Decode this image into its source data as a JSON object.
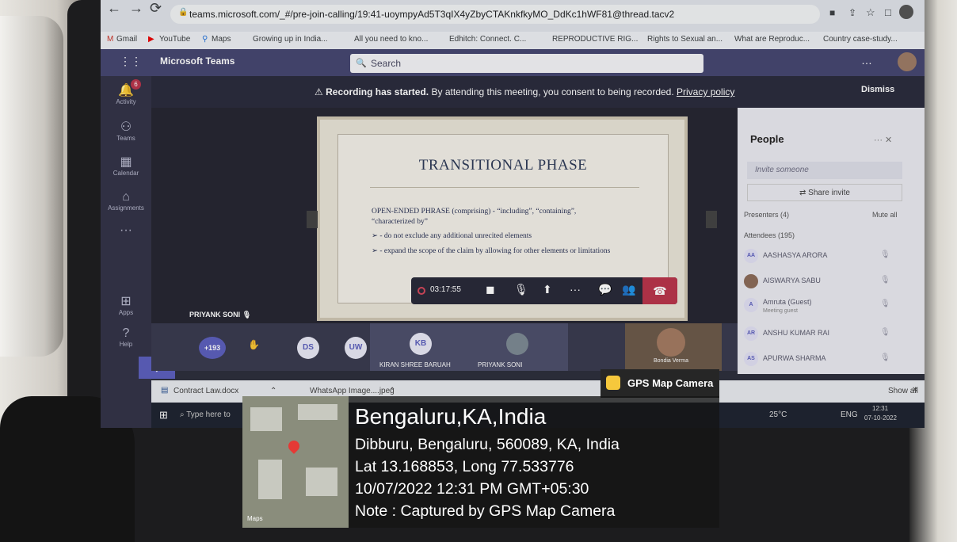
{
  "browser": {
    "url": "teams.microsoft.com/_#/pre-join-calling/19:41-uoympyAd5T3qIX4yZbyCTAKnkfkyMO_DdKc1hWF81@thread.tacv2",
    "bookmarks": [
      "Gmail",
      "YouTube",
      "Maps",
      "Growing up in India...",
      "All you need to kno...",
      "Edhitch: Connect. C...",
      "REPRODUCTIVE RIG...",
      "Rights to Sexual an...",
      "What are Reproduc...",
      "Country case-study..."
    ]
  },
  "teams": {
    "app_title": "Microsoft Teams",
    "search_placeholder": "Search",
    "rail": {
      "activity": "Activity",
      "activity_badge": "6",
      "teams": "Teams",
      "calendar": "Calendar",
      "assignments": "Assignments",
      "apps": "Apps",
      "help": "Help"
    },
    "banner": {
      "bold": "Recording has started.",
      "text": " By attending this meeting, you consent to being recorded. ",
      "link": "Privacy policy",
      "dismiss": "Dismiss"
    },
    "slide": {
      "title": "TRANSITIONAL PHASE",
      "line1": "OPEN-ENDED PHRASE (comprising) - “including”, “containing”,",
      "line2": "“characterized by”",
      "bullet1": "➢ - do not exclude any additional unrecited elements",
      "bullet2": "➢ - expand the scope of the claim by allowing for other elements or limitations"
    },
    "presenter": "PRIYANK SONI",
    "timer": "03:17:55",
    "gallery": {
      "overflow": "+193",
      "avatars": [
        "DS",
        "UW"
      ],
      "kb_initials": "KB",
      "kb_name": "KIRAN SHREE BARUAH",
      "priyank": "PRIYANK SONI",
      "pink_name": "Bondia Verma"
    },
    "people": {
      "title": "People",
      "invite_placeholder": "Invite someone",
      "share_invite": "Share invite",
      "presenters": "Presenters (4)",
      "mute_all": "Mute all",
      "attendees": "Attendees (195)",
      "show_all": "Show all",
      "list": [
        {
          "initials": "AA",
          "name": "AASHASYA ARORA",
          "sub": ""
        },
        {
          "initials": "",
          "name": "AISWARYA SABU",
          "sub": ""
        },
        {
          "initials": "A",
          "name": "Amruta (Guest)",
          "sub": "Meeting guest"
        },
        {
          "initials": "AR",
          "name": "ANSHU KUMAR RAI",
          "sub": ""
        },
        {
          "initials": "AS",
          "name": "APURWA SHARMA",
          "sub": ""
        }
      ]
    }
  },
  "taskbar": {
    "download1": "Contract Law.docx",
    "download2": "WhatsApp Image....jpeg",
    "search": "Type here to",
    "temp": "25°C",
    "lang": "ENG",
    "time": "12:31",
    "date": "07-10-2022"
  },
  "gps": {
    "header": "GPS Map Camera",
    "city": "Bengaluru,KA,India",
    "address": "Dibburu, Bengaluru, 560089, KA, India",
    "coords": "Lat 13.168853, Long 77.533776",
    "datetime": "10/07/2022 12:31 PM GMT+05:30",
    "note": "Note : Captured by GPS Map Camera",
    "map_credit": "Maps"
  }
}
